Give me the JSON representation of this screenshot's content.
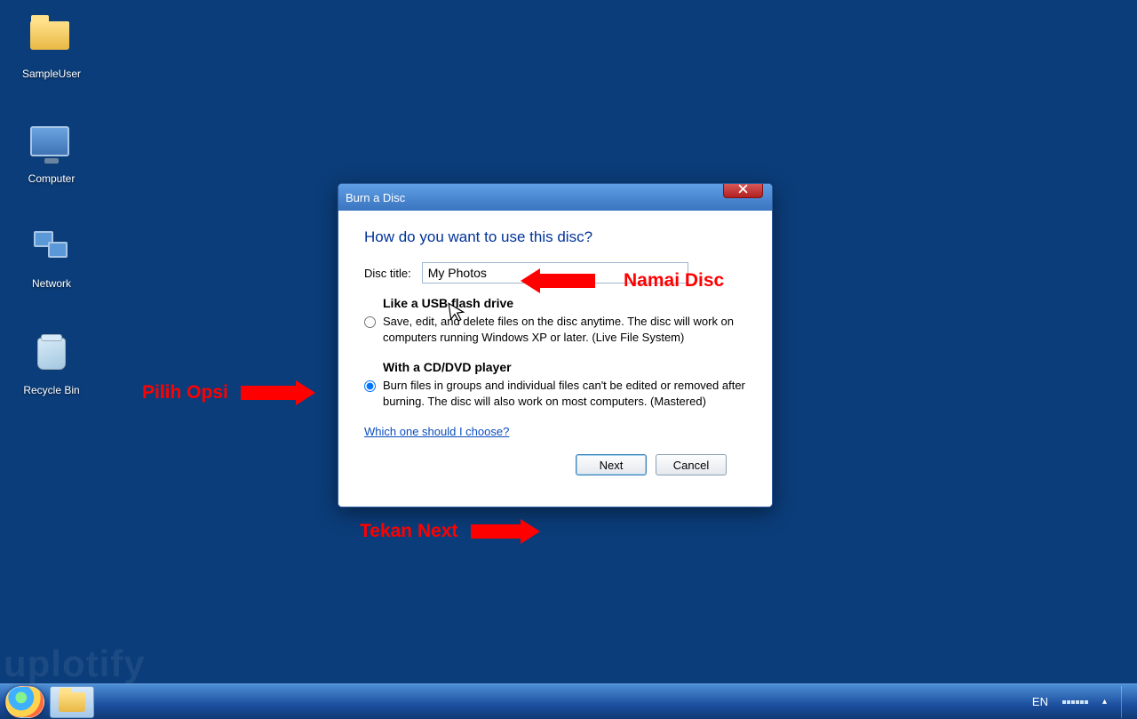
{
  "desktop": {
    "icons": [
      {
        "label": "SampleUser",
        "name": "user-folder"
      },
      {
        "label": "Computer",
        "name": "computer"
      },
      {
        "label": "Network",
        "name": "network"
      },
      {
        "label": "Recycle Bin",
        "name": "recycle-bin"
      }
    ]
  },
  "dialog": {
    "title": "Burn a Disc",
    "heading": "How do you want to use this disc?",
    "disc_title_label": "Disc title:",
    "disc_title_value": "My Photos",
    "options": [
      {
        "title": "Like a USB flash drive",
        "desc": "Save, edit, and delete files on the disc anytime. The disc will work on computers running Windows XP or later. (Live File System)",
        "checked": false
      },
      {
        "title": "With a CD/DVD player",
        "desc": "Burn files in groups and individual files can't be edited or removed after burning. The disc will also work on most computers. (Mastered)",
        "checked": true
      }
    ],
    "help_link": "Which one should I choose?",
    "buttons": {
      "next": "Next",
      "cancel": "Cancel"
    }
  },
  "annotations": {
    "pick_option": "Pilih Opsi",
    "name_disc": "Namai Disc",
    "press_next": "Tekan Next"
  },
  "taskbar": {
    "language": "EN"
  },
  "watermark": "uplotify"
}
